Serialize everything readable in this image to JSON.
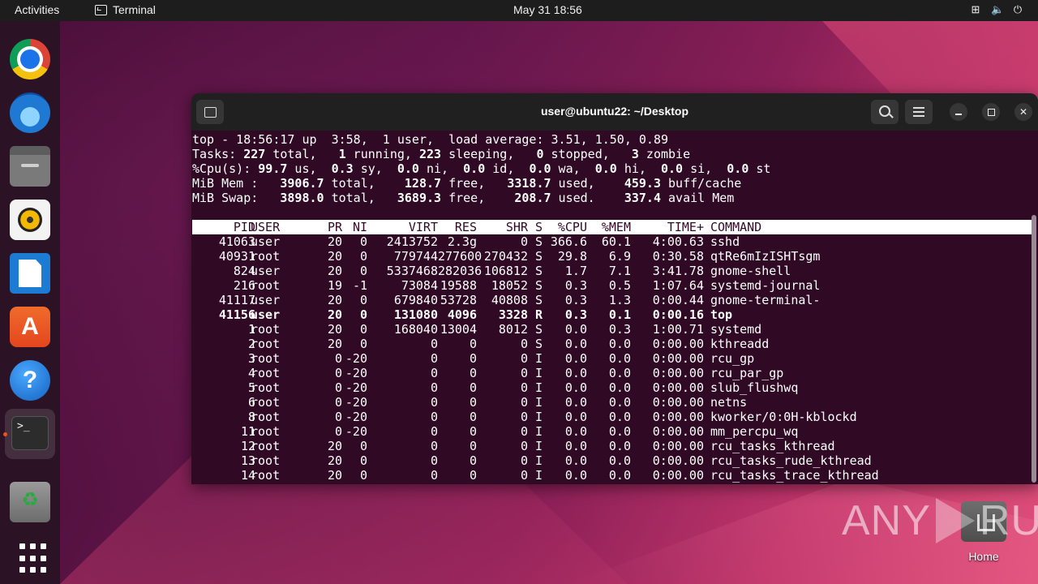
{
  "topbar": {
    "activities": "Activities",
    "app_name": "Terminal",
    "clock": "May 31  18:56"
  },
  "dock": {
    "items": [
      "google-chrome",
      "thunderbird",
      "files",
      "rhythmbox",
      "libreoffice-writer",
      "ubuntu-software",
      "help",
      "terminal",
      "trash",
      "show-applications"
    ]
  },
  "desktop": {
    "home_label": "Home",
    "watermark": "ANY RUN"
  },
  "terminal": {
    "title": "user@ubuntu22: ~/Desktop",
    "summary": {
      "line1": "top - 18:56:17 up  3:58,  1 user,  load average: 3.51, 1.50, 0.89",
      "tasks": [
        "Tasks: ",
        "227",
        " total,   ",
        "1",
        " running, ",
        "223",
        " sleeping,   ",
        "0",
        " stopped,   ",
        "3",
        " zombie"
      ],
      "cpu": [
        "%Cpu(s): ",
        "99.7",
        " us,  ",
        "0.3",
        " sy,  ",
        "0.0",
        " ni,  ",
        "0.0",
        " id,  ",
        "0.0",
        " wa,  ",
        "0.0",
        " hi,  ",
        "0.0",
        " si,  ",
        "0.0",
        " st"
      ],
      "mem": [
        "MiB Mem :   ",
        "3906.7",
        " total,    ",
        "128.7",
        " free,   ",
        "3318.7",
        " used,    ",
        "459.3",
        " buff/cache"
      ],
      "swap": [
        "MiB Swap:   ",
        "3898.0",
        " total,   ",
        "3689.3",
        " free,    ",
        "208.7",
        " used.    ",
        "337.4",
        " avail Mem"
      ]
    },
    "columns": [
      "PID",
      "USER",
      "PR",
      "NI",
      "VIRT",
      "RES",
      "SHR",
      "S",
      "%CPU",
      "%MEM",
      "TIME+",
      "COMMAND"
    ],
    "processes": [
      {
        "pid": "41063",
        "user": "user",
        "pr": "20",
        "ni": "0",
        "virt": "2413752",
        "res": "2.3g",
        "shr": "0",
        "s": "S",
        "cpu": "366.6",
        "mem": "60.1",
        "time": "4:00.63",
        "cmd": "sshd"
      },
      {
        "pid": "40931",
        "user": "root",
        "pr": "20",
        "ni": "0",
        "virt": "779744",
        "res": "277600",
        "shr": "270432",
        "s": "S",
        "cpu": "29.8",
        "mem": "6.9",
        "time": "0:30.58",
        "cmd": "qtRe6mIzISHTsgm"
      },
      {
        "pid": "824",
        "user": "user",
        "pr": "20",
        "ni": "0",
        "virt": "5337468",
        "res": "282036",
        "shr": "106812",
        "s": "S",
        "cpu": "1.7",
        "mem": "7.1",
        "time": "3:41.78",
        "cmd": "gnome-shell"
      },
      {
        "pid": "216",
        "user": "root",
        "pr": "19",
        "ni": "-1",
        "virt": "73084",
        "res": "19588",
        "shr": "18052",
        "s": "S",
        "cpu": "0.3",
        "mem": "0.5",
        "time": "1:07.64",
        "cmd": "systemd-journal"
      },
      {
        "pid": "41117",
        "user": "user",
        "pr": "20",
        "ni": "0",
        "virt": "679840",
        "res": "53728",
        "shr": "40808",
        "s": "S",
        "cpu": "0.3",
        "mem": "1.3",
        "time": "0:00.44",
        "cmd": "gnome-terminal-"
      },
      {
        "pid": "41156",
        "user": "user",
        "pr": "20",
        "ni": "0",
        "virt": "131080",
        "res": "4096",
        "shr": "3328",
        "s": "R",
        "cpu": "0.3",
        "mem": "0.1",
        "time": "0:00.16",
        "cmd": "top",
        "bold": true
      },
      {
        "pid": "1",
        "user": "root",
        "pr": "20",
        "ni": "0",
        "virt": "168040",
        "res": "13004",
        "shr": "8012",
        "s": "S",
        "cpu": "0.0",
        "mem": "0.3",
        "time": "1:00.71",
        "cmd": "systemd"
      },
      {
        "pid": "2",
        "user": "root",
        "pr": "20",
        "ni": "0",
        "virt": "0",
        "res": "0",
        "shr": "0",
        "s": "S",
        "cpu": "0.0",
        "mem": "0.0",
        "time": "0:00.00",
        "cmd": "kthreadd"
      },
      {
        "pid": "3",
        "user": "root",
        "pr": "0",
        "ni": "-20",
        "virt": "0",
        "res": "0",
        "shr": "0",
        "s": "I",
        "cpu": "0.0",
        "mem": "0.0",
        "time": "0:00.00",
        "cmd": "rcu_gp"
      },
      {
        "pid": "4",
        "user": "root",
        "pr": "0",
        "ni": "-20",
        "virt": "0",
        "res": "0",
        "shr": "0",
        "s": "I",
        "cpu": "0.0",
        "mem": "0.0",
        "time": "0:00.00",
        "cmd": "rcu_par_gp"
      },
      {
        "pid": "5",
        "user": "root",
        "pr": "0",
        "ni": "-20",
        "virt": "0",
        "res": "0",
        "shr": "0",
        "s": "I",
        "cpu": "0.0",
        "mem": "0.0",
        "time": "0:00.00",
        "cmd": "slub_flushwq"
      },
      {
        "pid": "6",
        "user": "root",
        "pr": "0",
        "ni": "-20",
        "virt": "0",
        "res": "0",
        "shr": "0",
        "s": "I",
        "cpu": "0.0",
        "mem": "0.0",
        "time": "0:00.00",
        "cmd": "netns"
      },
      {
        "pid": "8",
        "user": "root",
        "pr": "0",
        "ni": "-20",
        "virt": "0",
        "res": "0",
        "shr": "0",
        "s": "I",
        "cpu": "0.0",
        "mem": "0.0",
        "time": "0:00.00",
        "cmd": "kworker/0:0H-kblockd"
      },
      {
        "pid": "11",
        "user": "root",
        "pr": "0",
        "ni": "-20",
        "virt": "0",
        "res": "0",
        "shr": "0",
        "s": "I",
        "cpu": "0.0",
        "mem": "0.0",
        "time": "0:00.00",
        "cmd": "mm_percpu_wq"
      },
      {
        "pid": "12",
        "user": "root",
        "pr": "20",
        "ni": "0",
        "virt": "0",
        "res": "0",
        "shr": "0",
        "s": "I",
        "cpu": "0.0",
        "mem": "0.0",
        "time": "0:00.00",
        "cmd": "rcu_tasks_kthread"
      },
      {
        "pid": "13",
        "user": "root",
        "pr": "20",
        "ni": "0",
        "virt": "0",
        "res": "0",
        "shr": "0",
        "s": "I",
        "cpu": "0.0",
        "mem": "0.0",
        "time": "0:00.00",
        "cmd": "rcu_tasks_rude_kthread"
      },
      {
        "pid": "14",
        "user": "root",
        "pr": "20",
        "ni": "0",
        "virt": "0",
        "res": "0",
        "shr": "0",
        "s": "I",
        "cpu": "0.0",
        "mem": "0.0",
        "time": "0:00.00",
        "cmd": "rcu_tasks_trace_kthread"
      }
    ]
  },
  "colors": {
    "terminal_bg": "#300a24",
    "titlebar_bg": "#202020",
    "accent": "#e95420"
  }
}
